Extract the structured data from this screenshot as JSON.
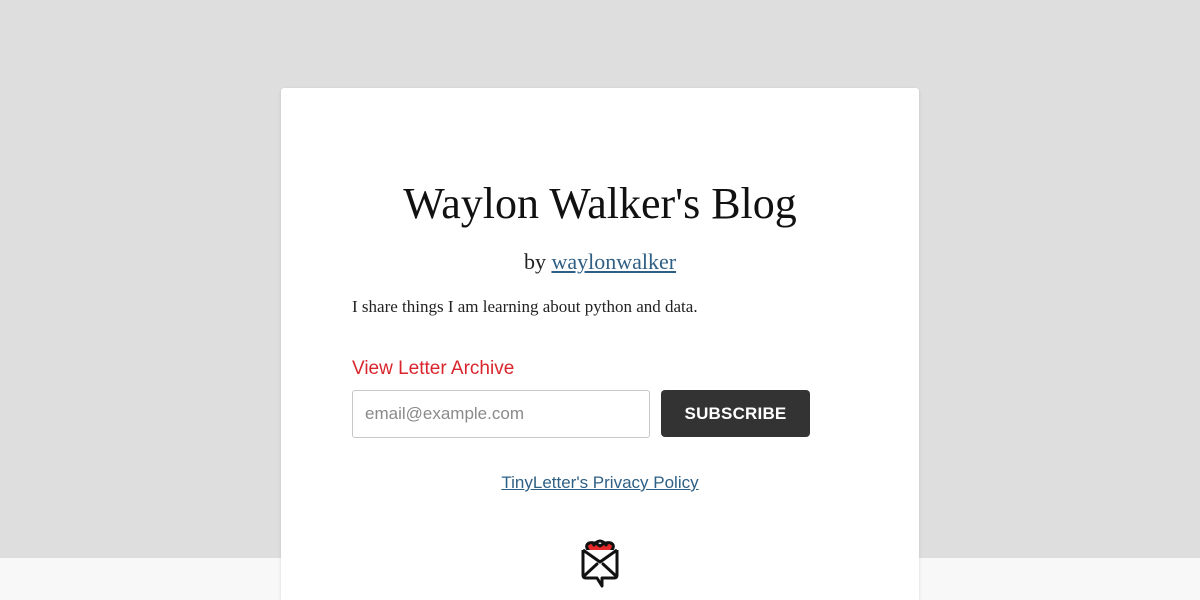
{
  "newsletter": {
    "title": "Waylon Walker's Blog",
    "byline_prefix": "by",
    "author_link": "waylonwalker",
    "description": "I share things I am learning about python and data.",
    "archive_link": "View Letter Archive",
    "email_placeholder": "email@example.com",
    "subscribe_label": "SUBSCRIBE",
    "privacy_link": "TinyLetter's Privacy Policy",
    "logo_icon": "tinyletter-heart-envelope-icon"
  },
  "colors": {
    "page_background": "#dedede",
    "card_background": "#ffffff",
    "link": "#2e5f85",
    "archive_link": "#d9262d",
    "button_background": "#333333",
    "heart": "#e62a2a"
  }
}
